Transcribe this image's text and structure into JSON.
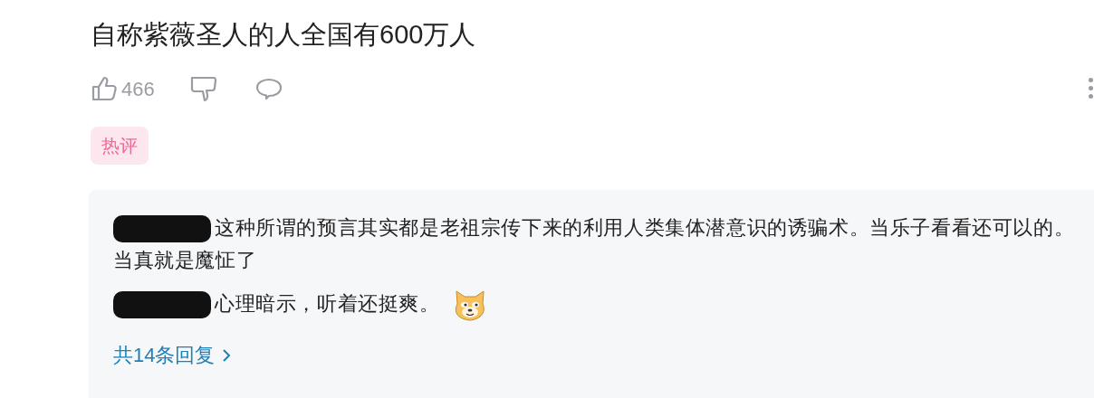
{
  "comment": {
    "text": "自称紫薇圣人的人全国有600万人",
    "like_count": "466",
    "tag": "热评"
  },
  "replies": [
    {
      "author_redacted": true,
      "text": "这种所谓的预言其实都是老祖宗传下来的利用人类集体潜意识的诱骗术。当乐子看看还可以的。当真就是魔怔了",
      "emoji": false
    },
    {
      "author_redacted": true,
      "text": "心理暗示，听着还挺爽。",
      "emoji": true
    }
  ],
  "more_replies": "共14条回复"
}
